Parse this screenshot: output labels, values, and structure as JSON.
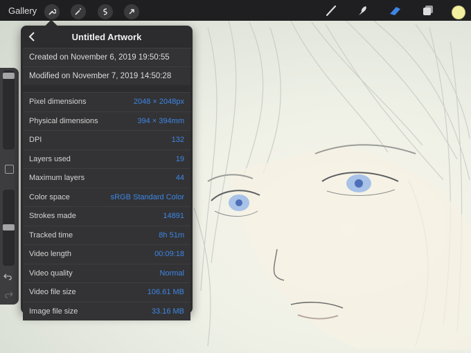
{
  "topbar": {
    "gallery_label": "Gallery",
    "tools": [
      "wrench-icon",
      "magic-wand-icon",
      "selection-icon",
      "transform-arrow-icon"
    ],
    "right_tools": [
      "brush-icon",
      "smudge-icon",
      "eraser-icon",
      "layers-icon"
    ],
    "accent_color": "#3d86e6",
    "current_color": "#f3efa0"
  },
  "panel": {
    "title": "Untitled Artwork",
    "created": "Created on November 6, 2019 19:50:55",
    "modified": "Modified on November 7, 2019 14:50:28",
    "rows": [
      {
        "label": "Pixel dimensions",
        "value": "2048 × 2048px"
      },
      {
        "label": "Physical dimensions",
        "value": "394 × 394mm"
      },
      {
        "label": "DPI",
        "value": "132"
      },
      {
        "label": "Layers used",
        "value": "19"
      },
      {
        "label": "Maximum layers",
        "value": "44"
      },
      {
        "label": "Color space",
        "value": "sRGB Standard Color"
      },
      {
        "label": "Strokes made",
        "value": "14891"
      },
      {
        "label": "Tracked time",
        "value": "8h 51m"
      },
      {
        "label": "Video length",
        "value": "00:09:18"
      },
      {
        "label": "Video quality",
        "value": "Normal"
      },
      {
        "label": "Video file size",
        "value": "106.61 MB"
      },
      {
        "label": "Image file size",
        "value": "33.16 MB"
      }
    ]
  }
}
